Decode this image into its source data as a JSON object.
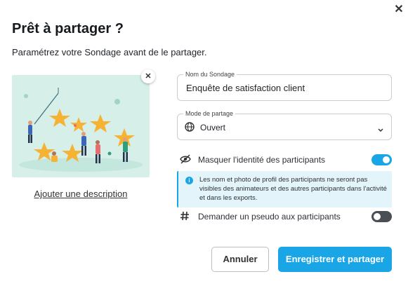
{
  "dialog": {
    "title": "Prêt à partager ?",
    "subtitle": "Paramétrez votre Sondage avant de le partager.",
    "close_icon": "close-icon"
  },
  "image": {
    "description_link": "Ajouter une description",
    "remove_icon": "close-icon"
  },
  "form": {
    "name_label": "Nom du Sondage",
    "name_value": "Enquête de satisfaction client",
    "mode_label": "Mode de partage",
    "mode_value": "Ouvert",
    "mode_icon": "globe-icon"
  },
  "options": {
    "mask_identity_label": "Masquer l'identité des participants",
    "mask_identity_on": true,
    "mask_icon": "eye-off-icon",
    "info_text": "Les nom et photo de profil des participants ne seront pas visibles des animateurs et des autres participants dans l'activité et dans les exports.",
    "pseudo_label": "Demander un pseudo aux participants",
    "pseudo_on": false,
    "pseudo_icon": "hashtag-icon"
  },
  "actions": {
    "cancel_label": "Annuler",
    "save_label": "Enregistrer et partager"
  },
  "colors": {
    "accent": "#1aa6e6",
    "illustration_bg": "#d6efe9",
    "star": "#f5b233"
  }
}
